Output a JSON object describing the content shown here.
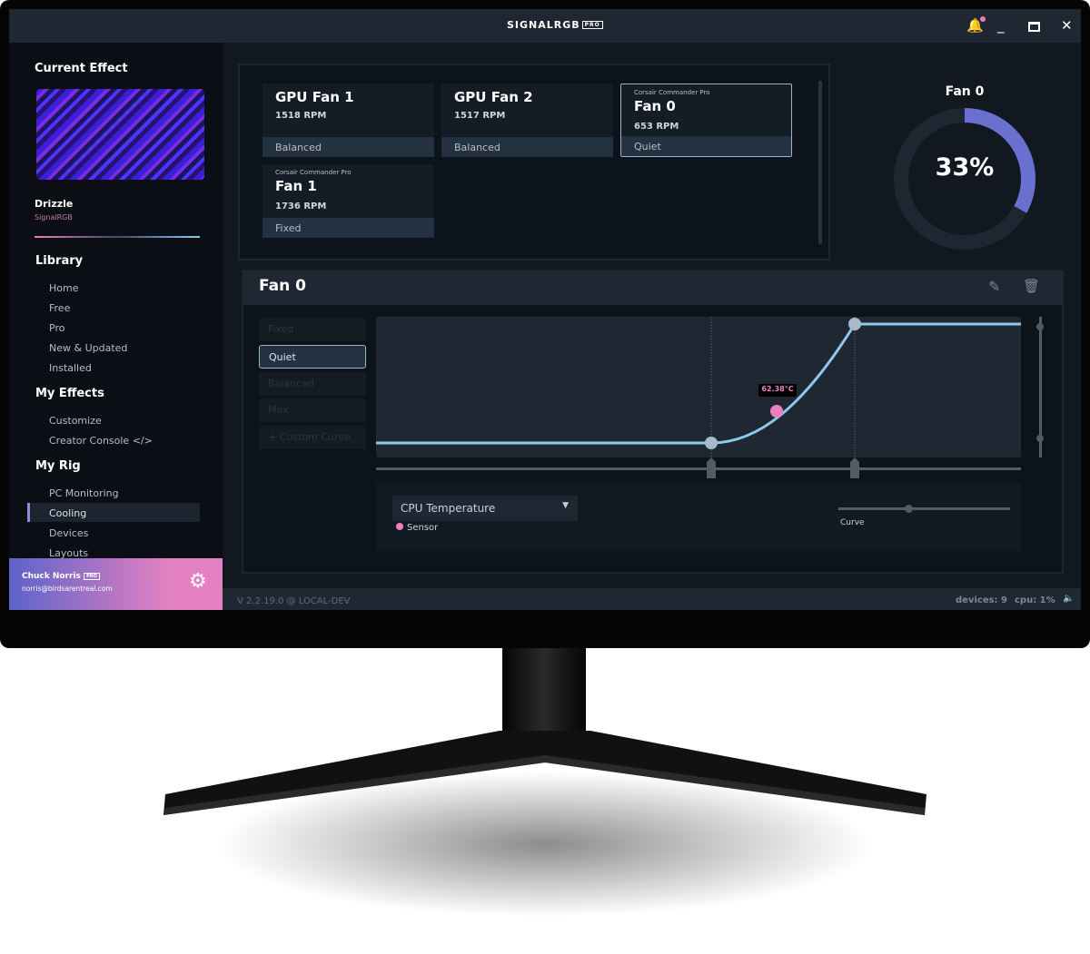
{
  "titlebar": {
    "logo": "SIGNALRGB",
    "logo_badge": "PRO"
  },
  "sidebar": {
    "current_effect_heading": "Current Effect",
    "effect_name": "Drizzle",
    "effect_author": "SignalRGB",
    "library_heading": "Library",
    "library_items": [
      "Home",
      "Free",
      "Pro",
      "New & Updated",
      "Installed"
    ],
    "my_effects_heading": "My Effects",
    "my_effects_items": [
      "Customize",
      "Creator Console </>"
    ],
    "my_rig_heading": "My Rig",
    "my_rig_items": [
      "PC Monitoring",
      "Cooling",
      "Devices",
      "Layouts"
    ],
    "active_item": "Cooling",
    "user": {
      "name": "Chuck Norris",
      "badge": "PRO",
      "email": "norris@birdsarentreal.com"
    }
  },
  "fans": [
    {
      "device": "",
      "name": "GPU Fan 1",
      "rpm": "1518 RPM",
      "mode": "Balanced"
    },
    {
      "device": "",
      "name": "GPU Fan 2",
      "rpm": "1517 RPM",
      "mode": "Balanced"
    },
    {
      "device": "Corsair Commander Pro",
      "name": "Fan 0",
      "rpm": "653 RPM",
      "mode": "Quiet",
      "selected": true
    },
    {
      "device": "Corsair Commander Pro",
      "name": "Fan 1",
      "rpm": "1736 RPM",
      "mode": "Fixed"
    }
  ],
  "gauge": {
    "title": "Fan 0",
    "value_label": "33%",
    "percent": 33
  },
  "editor": {
    "title": "Fan 0",
    "presets": [
      "Fixed",
      "Quiet",
      "Balanced",
      "Max",
      "+ Custom Curve"
    ],
    "active_preset": "Quiet",
    "sensor_marker_label": "62.38°C",
    "sensor_select": "CPU Temperature",
    "sensor_legend": "Sensor",
    "curve_label": "Curve",
    "curve_slider_percent": 41
  },
  "status": {
    "version": "V 2.2.19.0 @ LOCAL-DEV",
    "devices": "devices: 9",
    "cpu": "cpu: 1%"
  },
  "colors": {
    "accent_line": "#8ec8ec",
    "sensor": "#ee7fbf",
    "gauge": "#6a70d0"
  }
}
